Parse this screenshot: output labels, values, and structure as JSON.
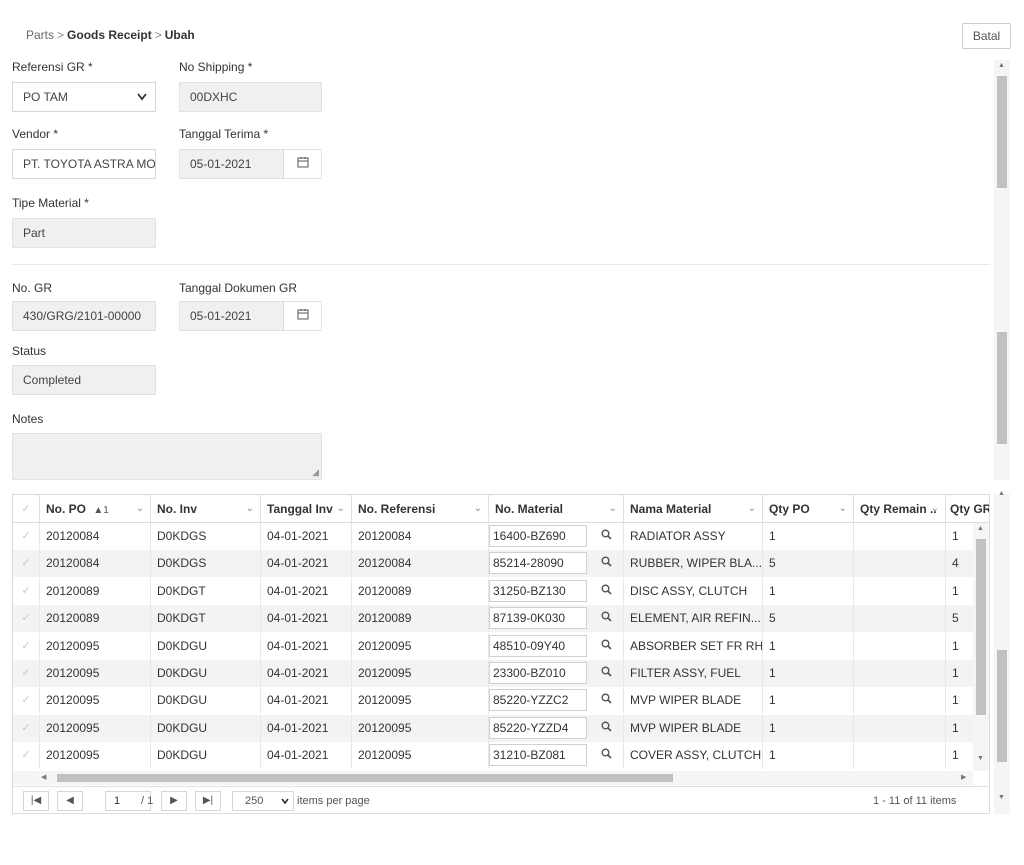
{
  "breadcrumb": {
    "parts": "Parts",
    "goods_receipt": "Goods Receipt",
    "ubah": "Ubah",
    "sep": ">"
  },
  "batal_label": "Batal",
  "form": {
    "referensi_gr": {
      "label": "Referensi GR *",
      "value": "PO TAM"
    },
    "no_shipping": {
      "label": "No Shipping *",
      "value": "00DXHC"
    },
    "vendor": {
      "label": "Vendor *",
      "value": "PT. TOYOTA ASTRA MO"
    },
    "tanggal_terima": {
      "label": "Tanggal Terima *",
      "value": "05-01-2021"
    },
    "tipe_material": {
      "label": "Tipe Material *",
      "value": "Part"
    },
    "no_gr": {
      "label": "No. GR",
      "value": "430/GRG/2101-00000"
    },
    "tanggal_dokumen_gr": {
      "label": "Tanggal Dokumen GR",
      "value": "05-01-2021"
    },
    "status": {
      "label": "Status",
      "value": "Completed"
    },
    "notes": {
      "label": "Notes",
      "value": ""
    }
  },
  "grid": {
    "columns": {
      "no_po": "No. PO",
      "no_po_sort": "▲1",
      "no_inv": "No. Inv",
      "tanggal_inv": "Tanggal Inv",
      "no_referensi": "No. Referensi",
      "no_material": "No. Material",
      "nama_material": "Nama Material",
      "qty_po": "Qty PO",
      "qty_remain": "Qty Remain ..",
      "qty_gr": "Qty GR"
    },
    "rows": [
      {
        "no_po": "20120084",
        "no_inv": "D0KDGS",
        "tanggal_inv": "04-01-2021",
        "no_ref": "20120084",
        "no_material": "16400-BZ690",
        "nama_material": "RADIATOR ASSY",
        "qty_po": "1",
        "qty_remain": "",
        "qty_gr": "1"
      },
      {
        "no_po": "20120084",
        "no_inv": "D0KDGS",
        "tanggal_inv": "04-01-2021",
        "no_ref": "20120084",
        "no_material": "85214-28090",
        "nama_material": "RUBBER, WIPER BLA...",
        "qty_po": "5",
        "qty_remain": "",
        "qty_gr": "4"
      },
      {
        "no_po": "20120089",
        "no_inv": "D0KDGT",
        "tanggal_inv": "04-01-2021",
        "no_ref": "20120089",
        "no_material": "31250-BZ130",
        "nama_material": "DISC ASSY, CLUTCH",
        "qty_po": "1",
        "qty_remain": "",
        "qty_gr": "1"
      },
      {
        "no_po": "20120089",
        "no_inv": "D0KDGT",
        "tanggal_inv": "04-01-2021",
        "no_ref": "20120089",
        "no_material": "87139-0K030",
        "nama_material": "ELEMENT, AIR REFIN...",
        "qty_po": "5",
        "qty_remain": "",
        "qty_gr": "5"
      },
      {
        "no_po": "20120095",
        "no_inv": "D0KDGU",
        "tanggal_inv": "04-01-2021",
        "no_ref": "20120095",
        "no_material": "48510-09Y40",
        "nama_material": "ABSORBER SET FR RH",
        "qty_po": "1",
        "qty_remain": "",
        "qty_gr": "1"
      },
      {
        "no_po": "20120095",
        "no_inv": "D0KDGU",
        "tanggal_inv": "04-01-2021",
        "no_ref": "20120095",
        "no_material": "23300-BZ010",
        "nama_material": "FILTER ASSY, FUEL",
        "qty_po": "1",
        "qty_remain": "",
        "qty_gr": "1"
      },
      {
        "no_po": "20120095",
        "no_inv": "D0KDGU",
        "tanggal_inv": "04-01-2021",
        "no_ref": "20120095",
        "no_material": "85220-YZZC2",
        "nama_material": "MVP WIPER BLADE",
        "qty_po": "1",
        "qty_remain": "",
        "qty_gr": "1"
      },
      {
        "no_po": "20120095",
        "no_inv": "D0KDGU",
        "tanggal_inv": "04-01-2021",
        "no_ref": "20120095",
        "no_material": "85220-YZZD4",
        "nama_material": "MVP WIPER BLADE",
        "qty_po": "1",
        "qty_remain": "",
        "qty_gr": "1"
      },
      {
        "no_po": "20120095",
        "no_inv": "D0KDGU",
        "tanggal_inv": "04-01-2021",
        "no_ref": "20120095",
        "no_material": "31210-BZ081",
        "nama_material": "COVER ASSY, CLUTCH",
        "qty_po": "1",
        "qty_remain": "",
        "qty_gr": "1"
      }
    ]
  },
  "pager": {
    "page": "1",
    "of_pages": "/ 1",
    "page_size": "250",
    "items_per_page": "items per page",
    "summary": "1 - 11 of 11 items"
  },
  "icons": {
    "dropdown": "chevron-down-icon",
    "calendar": "calendar-icon",
    "search": "search-icon",
    "checkmark": "check-icon",
    "first_page": "first-page-icon",
    "prev_page": "prev-page-icon",
    "next_page": "next-page-icon",
    "last_page": "last-page-icon"
  }
}
